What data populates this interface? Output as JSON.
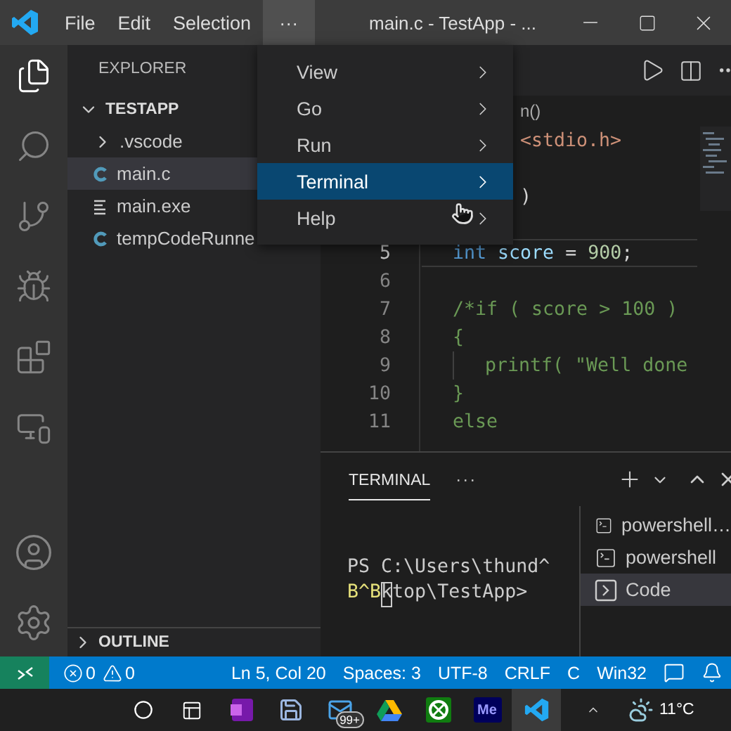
{
  "window": {
    "title": "main.c - TestApp - ..."
  },
  "menubar": [
    {
      "label": "File",
      "selected": false
    },
    {
      "label": "Edit",
      "selected": false
    },
    {
      "label": "Selection",
      "selected": false
    },
    {
      "label": "···",
      "selected": true
    }
  ],
  "menu": [
    {
      "label": "View",
      "selected": false
    },
    {
      "label": "Go",
      "selected": false
    },
    {
      "label": "Run",
      "selected": false
    },
    {
      "label": "Terminal",
      "selected": true
    },
    {
      "label": "Help",
      "selected": false
    }
  ],
  "sidebar": {
    "title": "EXPLORER",
    "tree": {
      "label": "TESTAPP",
      "expanded": true,
      "children": [
        {
          "label": ".vscode",
          "kind": "folder",
          "expanded": false,
          "selected": false
        },
        {
          "label": "main.c",
          "kind": "c",
          "selected": true
        },
        {
          "label": "main.exe",
          "kind": "exe",
          "selected": false
        },
        {
          "label": "tempCodeRunne",
          "kind": "c",
          "selected": false
        }
      ]
    },
    "outline": {
      "label": "OUTLINE",
      "expanded": false
    }
  },
  "editor": {
    "breadcrumb": "n()",
    "lines": [
      {
        "kind": "fragment",
        "tokens": [
          {
            "text": "<stdio.h>",
            "kind": "string"
          }
        ]
      },
      {
        "kind": "blank"
      },
      {
        "kind": "fragment",
        "tokens": [
          {
            "text": ")",
            "kind": "plain"
          }
        ]
      },
      {
        "kind": "blank"
      },
      {
        "number": "5",
        "current": true,
        "tokens": [
          {
            "text": "int",
            "kind": "keyword"
          },
          {
            "text": " score",
            "kind": "variable"
          },
          {
            "text": " = ",
            "kind": "plain"
          },
          {
            "text": "900",
            "kind": "number"
          },
          {
            "text": ";",
            "kind": "plain"
          }
        ]
      },
      {
        "number": "6"
      },
      {
        "number": "7",
        "tokens": [
          {
            "text": "/*if ( score > 100 )",
            "kind": "comment"
          }
        ]
      },
      {
        "number": "8",
        "tokens": [
          {
            "text": "{",
            "kind": "comment"
          }
        ]
      },
      {
        "number": "9",
        "indented": true,
        "tokens": [
          {
            "text": "printf( \"Well done",
            "kind": "comment"
          }
        ]
      },
      {
        "number": "10",
        "tokens": [
          {
            "text": "}",
            "kind": "comment"
          }
        ]
      },
      {
        "number": "11",
        "tokens": [
          {
            "text": "else",
            "kind": "comment"
          }
        ]
      }
    ]
  },
  "panel": {
    "tabs": [
      {
        "label": "TERMINAL",
        "selected": true
      }
    ],
    "more": "···",
    "lines": [
      [
        {
          "text": "PS C:\\Users\\thund^",
          "kind": "plain"
        }
      ],
      [
        {
          "text": "B^B",
          "kind": "control"
        },
        {
          "text": "k",
          "kind": "cursor"
        },
        {
          "text": "top\\TestApp>",
          "kind": "plain"
        }
      ]
    ],
    "terminals": [
      {
        "label": "powershell…",
        "kind": "shell",
        "selected": false
      },
      {
        "label": "powershell",
        "kind": "shell",
        "selected": false
      },
      {
        "label": "Code",
        "kind": "task",
        "selected": true
      }
    ]
  },
  "status_bar": {
    "errors": "0",
    "warnings": "0",
    "items": [
      "Ln 5, Col 20",
      "Spaces: 3",
      "UTF-8",
      "CRLF",
      "C",
      "Win32"
    ]
  },
  "taskbar": {
    "apps": [
      {
        "kind": "notes",
        "selected": false
      },
      {
        "kind": "save",
        "selected": false
      },
      {
        "kind": "mail",
        "badge": "99+",
        "selected": false
      },
      {
        "kind": "drive",
        "selected": false
      },
      {
        "kind": "xbox",
        "selected": false
      },
      {
        "kind": "media",
        "label": "Me",
        "selected": false
      },
      {
        "kind": "code",
        "selected": true
      }
    ],
    "weather": "11°C"
  }
}
